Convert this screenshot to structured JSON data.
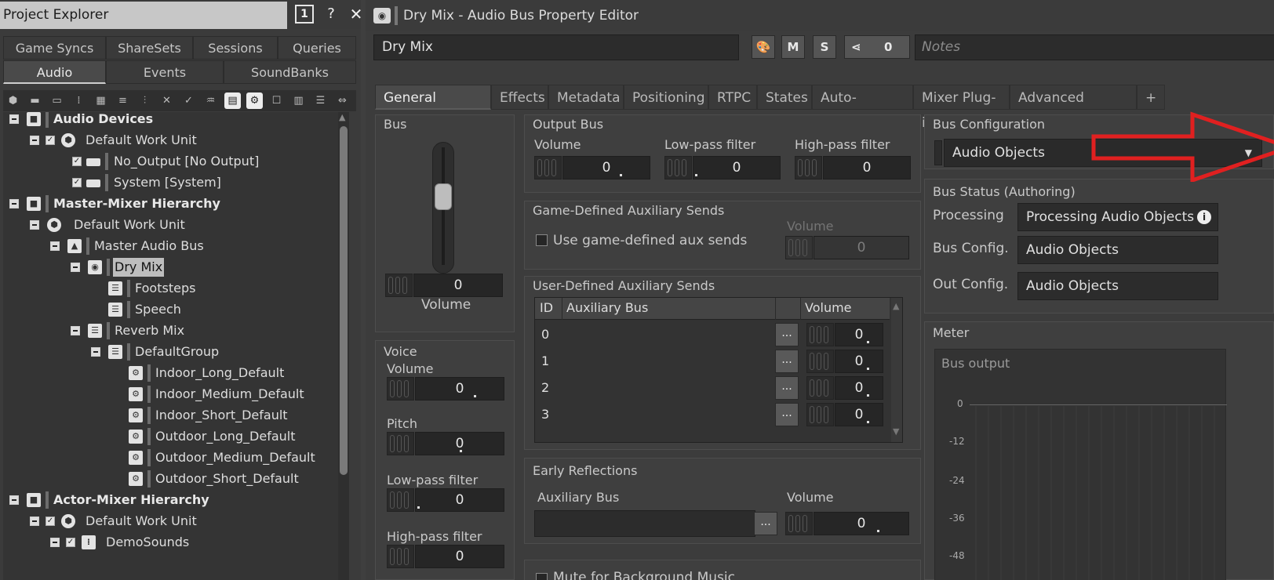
{
  "explorer": {
    "title": "Project Explorer",
    "badge": "1",
    "help": "?",
    "close": "✕",
    "tabs_row1": [
      "Game Syncs",
      "ShareSets",
      "Sessions",
      "Queries"
    ],
    "tabs_row2": [
      "Audio",
      "Events",
      "SoundBanks"
    ],
    "active_tab": "Audio",
    "tree": [
      {
        "label": "Audio Devices",
        "bold": true
      },
      {
        "label": "Default Work Unit"
      },
      {
        "label": "No_Output [No Output]"
      },
      {
        "label": "System [System]"
      },
      {
        "label": "Master-Mixer Hierarchy",
        "bold": true
      },
      {
        "label": "Default Work Unit"
      },
      {
        "label": "Master Audio Bus"
      },
      {
        "label": "Dry Mix",
        "selected": true
      },
      {
        "label": "Footsteps"
      },
      {
        "label": "Speech"
      },
      {
        "label": "Reverb Mix"
      },
      {
        "label": "DefaultGroup"
      },
      {
        "label": "Indoor_Long_Default"
      },
      {
        "label": "Indoor_Medium_Default"
      },
      {
        "label": "Indoor_Short_Default"
      },
      {
        "label": "Outdoor_Long_Default"
      },
      {
        "label": "Outdoor_Medium_Default"
      },
      {
        "label": "Outdoor_Short_Default"
      },
      {
        "label": "Actor-Mixer Hierarchy",
        "bold": true
      },
      {
        "label": "Default Work Unit"
      },
      {
        "label": "DemoSounds"
      }
    ]
  },
  "editor": {
    "title": "Dry Mix - Audio Bus Property Editor",
    "name_value": "Dry Mix",
    "btn_m": "M",
    "btn_s": "S",
    "share_count": "0",
    "notes_placeholder": "Notes",
    "tabs": [
      "General Settings",
      "Effects",
      "Metadata",
      "Positioning",
      "RTPC",
      "States",
      "Auto-ducking",
      "Mixer Plug-in",
      "Advanced Settings",
      "+"
    ],
    "active_tab": "General Settings",
    "bus": {
      "label": "Bus",
      "volume_value": "0",
      "volume_label": "Volume"
    },
    "voice": {
      "label": "Voice",
      "volume_label": "Volume",
      "volume_value": "0",
      "pitch_label": "Pitch",
      "pitch_value": "0",
      "lpf_label": "Low-pass filter",
      "lpf_value": "0",
      "hpf_label": "High-pass filter",
      "hpf_value": "0"
    },
    "output_bus": {
      "label": "Output Bus",
      "volume_label": "Volume",
      "volume_value": "0",
      "lpf_label": "Low-pass filter",
      "lpf_value": "0",
      "hpf_label": "High-pass filter",
      "hpf_value": "0"
    },
    "game_aux": {
      "label": "Game-Defined Auxiliary Sends",
      "checkbox_label": "Use game-defined aux sends",
      "volume_label": "Volume",
      "volume_value": "0"
    },
    "user_aux": {
      "label": "User-Defined Auxiliary Sends",
      "col_id": "ID",
      "col_bus": "Auxiliary Bus",
      "col_volume": "Volume",
      "rows": [
        {
          "id": "0",
          "bus": "",
          "volume": "0"
        },
        {
          "id": "1",
          "bus": "",
          "volume": "0"
        },
        {
          "id": "2",
          "bus": "",
          "volume": "0"
        },
        {
          "id": "3",
          "bus": "",
          "volume": "0"
        }
      ],
      "more": "..."
    },
    "early_reflections": {
      "label": "Early Reflections",
      "bus_label": "Auxiliary Bus",
      "volume_label": "Volume",
      "volume_value": "0",
      "more": "..."
    },
    "mute_bg_label": "Mute for Background Music",
    "bus_config": {
      "label": "Bus Configuration",
      "value": "Audio Objects"
    },
    "bus_status": {
      "label": "Bus Status (Authoring)",
      "processing_label": "Processing",
      "processing_value": "Processing Audio Objects",
      "config_label": "Bus Config.",
      "config_value": "Audio Objects",
      "out_label": "Out Config.",
      "out_value": "Audio Objects"
    },
    "meter": {
      "label": "Meter",
      "title": "Bus output",
      "ticks": [
        "0",
        "-12",
        "-24",
        "-36",
        "-48"
      ]
    },
    "colors": {
      "annotation_arrow": "#e02020",
      "selected_row": "#bdbdbd"
    }
  }
}
